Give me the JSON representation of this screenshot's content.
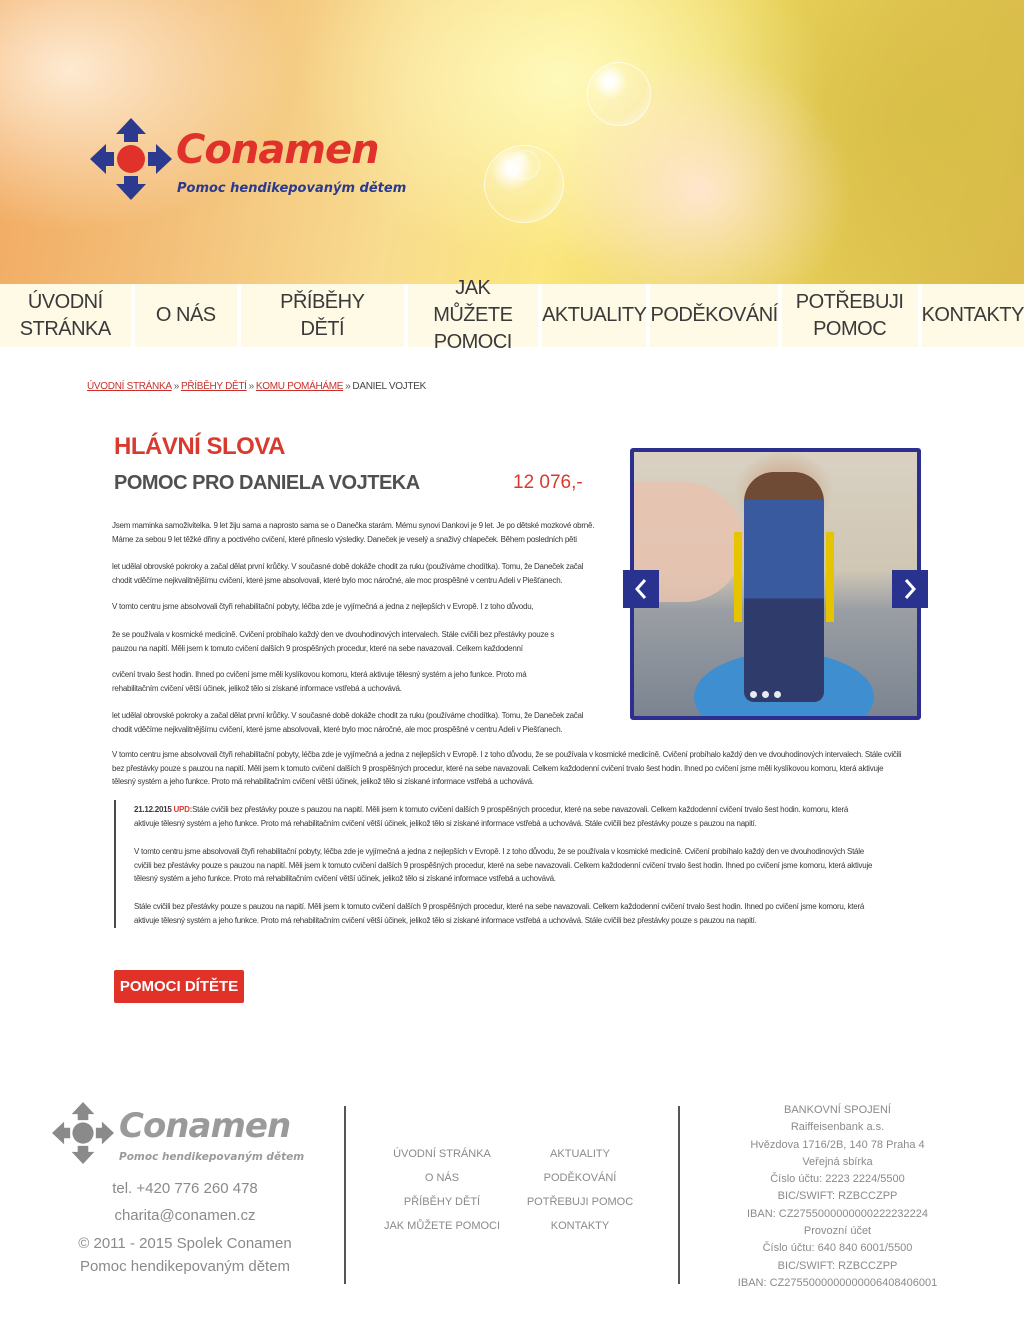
{
  "header": {
    "logo": {
      "name": "Conamen",
      "tagline": "Pomoc hendikepovaným dětem"
    }
  },
  "nav": [
    {
      "label": "Úvodní stránka"
    },
    {
      "label": "O nás"
    },
    {
      "label": "Příběhy dětí"
    },
    {
      "label": "Jak můžete pomoci"
    },
    {
      "label": "Aktuality"
    },
    {
      "label": "Poděkování"
    },
    {
      "label": "Potřebuji pomoc"
    },
    {
      "label": "Kontakty"
    }
  ],
  "breadcrumb": {
    "items": [
      "Úvodní stránka",
      "Příběhy dětí",
      "Komu pomáháme"
    ],
    "separator": "»",
    "current": "Daniel Vojtek"
  },
  "article": {
    "kicker": "Hlávní slova",
    "title": "Pomoc pro Daniela Vojteka",
    "amount": "12 076,-",
    "paragraphs": [
      "Jsem maminka samoživitelka. 9 let žiju sama a naprosto sama se o Danečka starám. Mému synovi Dankovi je 9 let. Je po dětské mozkové obrně. Máme za sebou 9 let těžké dřiny a poctivého cvičení, které přineslo výsledky. Daneček je veselý a snaživý chlapeček. Během posledních pěti",
      "let udělal obrovské pokroky a začal dělat první krůčky. V současné době dokáže chodit za ruku (používáme chodítka). Tomu, že Daneček začal chodit vděčíme nejkvalitnějšímu cvičení, které jsme absolvovali, které bylo moc náročné, ale moc prospěšné v centru Adeli v Piešťanech.",
      "V tomto centru jsme absolvovali čtyři rehabilitační pobyty, léčba zde je vyjímečná a jedna z nejlepších v Evropě. I z toho důvodu,",
      "že se používala v kosmické medicíně. Cvičení probíhalo každý den ve dvouhodinových intervalech. Stále cvičili bez přestávky pouze s pauzou na napití. Měli jsem k tomuto cvičení dalších 9 prospěšných procedur, které na sebe navazovali. Celkem každodenní",
      "cvičení trvalo šest hodin. Ihned po cvičení jsme měli kyslíkovou komoru, která aktivuje tělesný systém a jeho funkce. Proto má rehabilitačním cvičení větší účinek, jelikož tělo si získané informace vstřebá a uchovává.",
      "let udělal obrovské pokroky a začal dělat první krůčky. V současné době dokáže chodit za ruku (používáme chodítka). Tomu, že Daneček začal chodit vděčíme nejkvalitnějšímu cvičení, které jsme absolvovali, které bylo moc náročné, ale moc prospěšné v centru Adeli v Piešťanech.",
      "V tomto centru jsme absolvovali čtyři rehabilitační pobyty, léčba zde je vyjímečná a jedna z nejlepších v Evropě. I z toho důvodu, že se používala v kosmické medicíně. Cvičení probíhalo každý den ve dvouhodinových intervalech. Stále cvičili bez přestávky pouze s pauzou na napití. Měli jsem k tomuto cvičení dalších 9 prospěšných procedur, které na sebe navazovali. Celkem každodenní cvičení trvalo šest hodin. Ihned po cvičení jsme měli kyslíkovou komoru, která aktivuje tělesný systém a jeho funkce. Proto má rehabilitačním cvičení větší účinek, jelikož tělo si získané informace vstřebá a uchovává."
    ],
    "update": {
      "date": "21.12.2015",
      "tag": "UPD:",
      "p1": "Stále cvičili bez přestávky pouze s pauzou na napití. Měli jsem k tomuto cvičení dalších 9 prospěšných procedur, které na sebe navazovali. Celkem každodenní cvičení trvalo šest hodin. komoru, která aktivuje tělesný systém a jeho funkce. Proto má rehabilitačním cvičení větší účinek, jelikož tělo si získané informace vstřebá a uchovává. Stále cvičili bez přestávky pouze s pauzou na napití.",
      "p2": "V tomto centru jsme absolvovali čtyři rehabilitační pobyty, léčba zde je vyjímečná a jedna z nejlepších v Evropě. I z toho důvodu, že se používala v kosmické medicíně. Cvičení probíhalo každý den ve dvouhodinových Stále cvičili bez přestávky pouze s pauzou na napití. Měli jsem k tomuto cvičení dalších 9 prospěšných procedur, které na sebe navazovali. Celkem každodenní cvičení trvalo šest hodin. Ihned po cvičení jsme komoru, která aktivuje tělesný systém a jeho funkce. Proto má rehabilitačním cvičení větší účinek, jelikož tělo si získané informace vstřebá a uchovává.",
      "p3": "Stále cvičili bez přestávky pouze s pauzou na napití. Měli jsem k tomuto cvičení dalších 9 prospěšných procedur, které na sebe navazovali. Celkem každodenní cvičení trvalo šest hodin. Ihned po cvičení jsme komoru, která aktivuje tělesný systém a jeho funkce. Proto má rehabilitačním cvičení větší účinek, jelikož tělo si získané informace vstřebá a uchovává. Stále cvičili bez přestávky pouze s pauzou na napití."
    },
    "cta": "Pomoci dítěte"
  },
  "gallery": {
    "slides": 3,
    "active": 1
  },
  "footer": {
    "logo": {
      "name": "Conamen",
      "tagline": "Pomoc hendikepovaným dětem"
    },
    "phone": "tel. +420 776 260 478",
    "email": "charita@conamen.cz",
    "copyright": "© 2011 - 2015 Spolek Conamen",
    "org": "Pomoc hendikepovaným dětem",
    "nav_left": [
      "Úvodní stránka",
      "O nás",
      "Příběhy dětí",
      "Jak můžete pomoci"
    ],
    "nav_right": [
      "Aktuality",
      "Poděkování",
      "Potřebuji pomoc",
      "Kontakty"
    ],
    "bank": [
      "BANKOVNÍ SPOJENÍ",
      "Raiffeisenbank a.s.",
      "Hvězdova 1716/2B, 140 78 Praha 4",
      "Veřejná sbírka",
      "Číslo účtu: 2223 2224/5500",
      "BIC/SWIFT: RZBCCZPP",
      "IBAN: CZ2755000000000222232224",
      "Provozní účet",
      "Číslo účtu: 640 840 6001/5500",
      "BIC/SWIFT: RZBCCZPP",
      "IBAN: CZ2755000000000006408406001"
    ]
  },
  "colors": {
    "accent": "#e03228",
    "navy": "#2a3290",
    "nav_bg": "#fff8de"
  }
}
